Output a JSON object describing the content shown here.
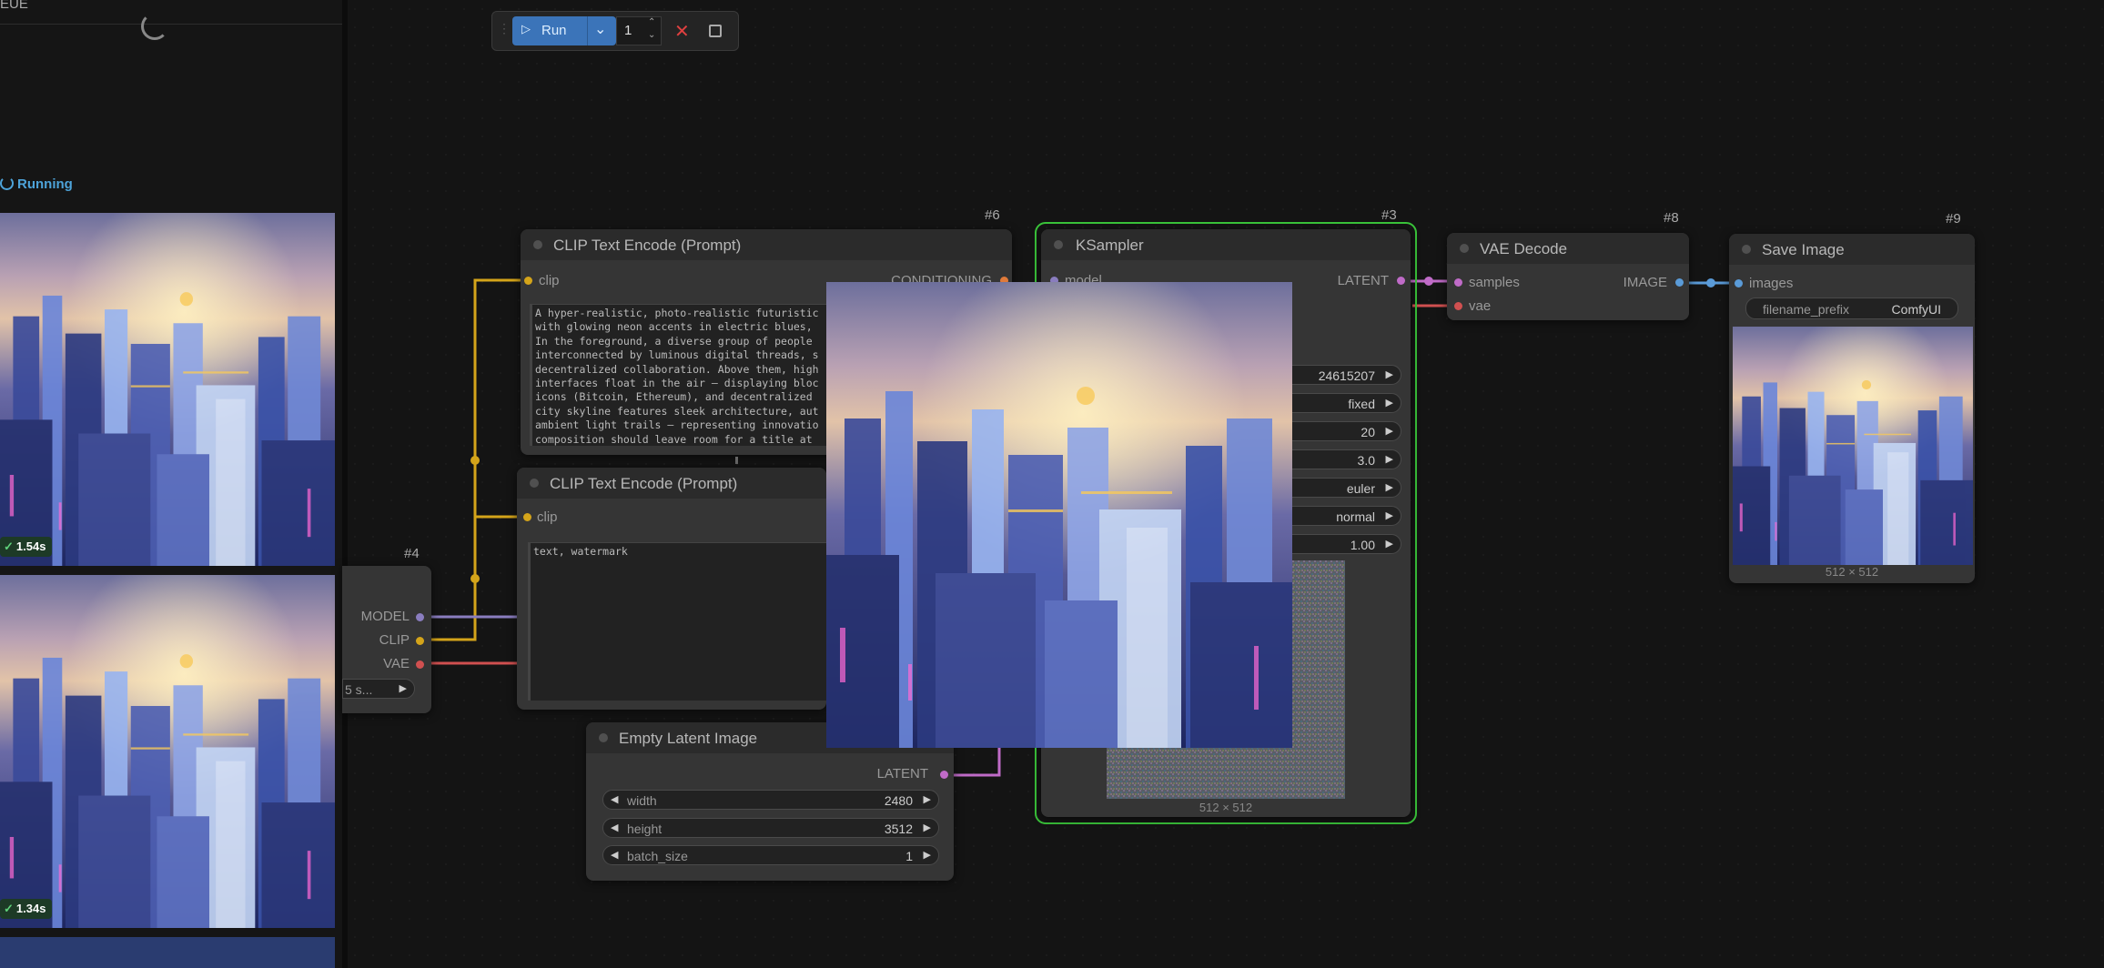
{
  "queue": {
    "title": "EUE",
    "running_label": "Running",
    "items": [
      {
        "time": "1.54s"
      },
      {
        "time": "1.34s"
      }
    ]
  },
  "toolbar": {
    "run_label": "Run",
    "batch_count": "1"
  },
  "nodes": {
    "checkpoint": {
      "id": "#4",
      "outputs": [
        "MODEL",
        "CLIP",
        "VAE"
      ],
      "ckpt_value": "5 s..."
    },
    "clip_pos": {
      "id": "#6",
      "title": "CLIP Text Encode (Prompt)",
      "input": "clip",
      "output": "CONDITIONING",
      "text_lines": [
        "A hyper-realistic, photo-realistic futuristic",
        "with glowing neon accents in electric blues,",
        "In the foreground, a diverse group of people",
        "interconnected by luminous digital threads, s",
        "decentralized collaboration. Above them, high",
        "interfaces float in the air — displaying bloc",
        "icons (Bitcoin, Ethereum), and decentralized",
        "city skyline features sleek architecture, aut",
        "ambient light trails — representing innovatio",
        "composition should leave room for a title at"
      ]
    },
    "clip_neg": {
      "title": "CLIP Text Encode (Prompt)",
      "input": "clip",
      "text": "text, watermark"
    },
    "empty_latent": {
      "title": "Empty Latent Image",
      "output": "LATENT",
      "widgets": [
        {
          "label": "width",
          "value": "2480"
        },
        {
          "label": "height",
          "value": "3512"
        },
        {
          "label": "batch_size",
          "value": "1"
        }
      ]
    },
    "ksampler": {
      "id": "#3",
      "title": "KSampler",
      "input": "model",
      "output": "LATENT",
      "widget_values": [
        "24615207",
        "fixed",
        "20",
        "3.0",
        "euler",
        "normal",
        "1.00"
      ],
      "image_size": "512 × 512"
    },
    "vae_decode": {
      "id": "#8",
      "title": "VAE Decode",
      "inputs": [
        "samples",
        "vae"
      ],
      "output": "IMAGE"
    },
    "save_image": {
      "id": "#9",
      "title": "Save Image",
      "input": "images",
      "prefix_label": "filename_prefix",
      "prefix_value": "ComfyUI",
      "image_size": "512 × 512"
    }
  },
  "colors": {
    "clip_wire": "#d4a41a",
    "model_wire": "#8a7dbf",
    "vae_wire": "#d05050",
    "latent_wire": "#c06bc8",
    "image_wire": "#5a9bd8",
    "running_outline": "#3ac43a",
    "run_button": "#3b74b9"
  }
}
